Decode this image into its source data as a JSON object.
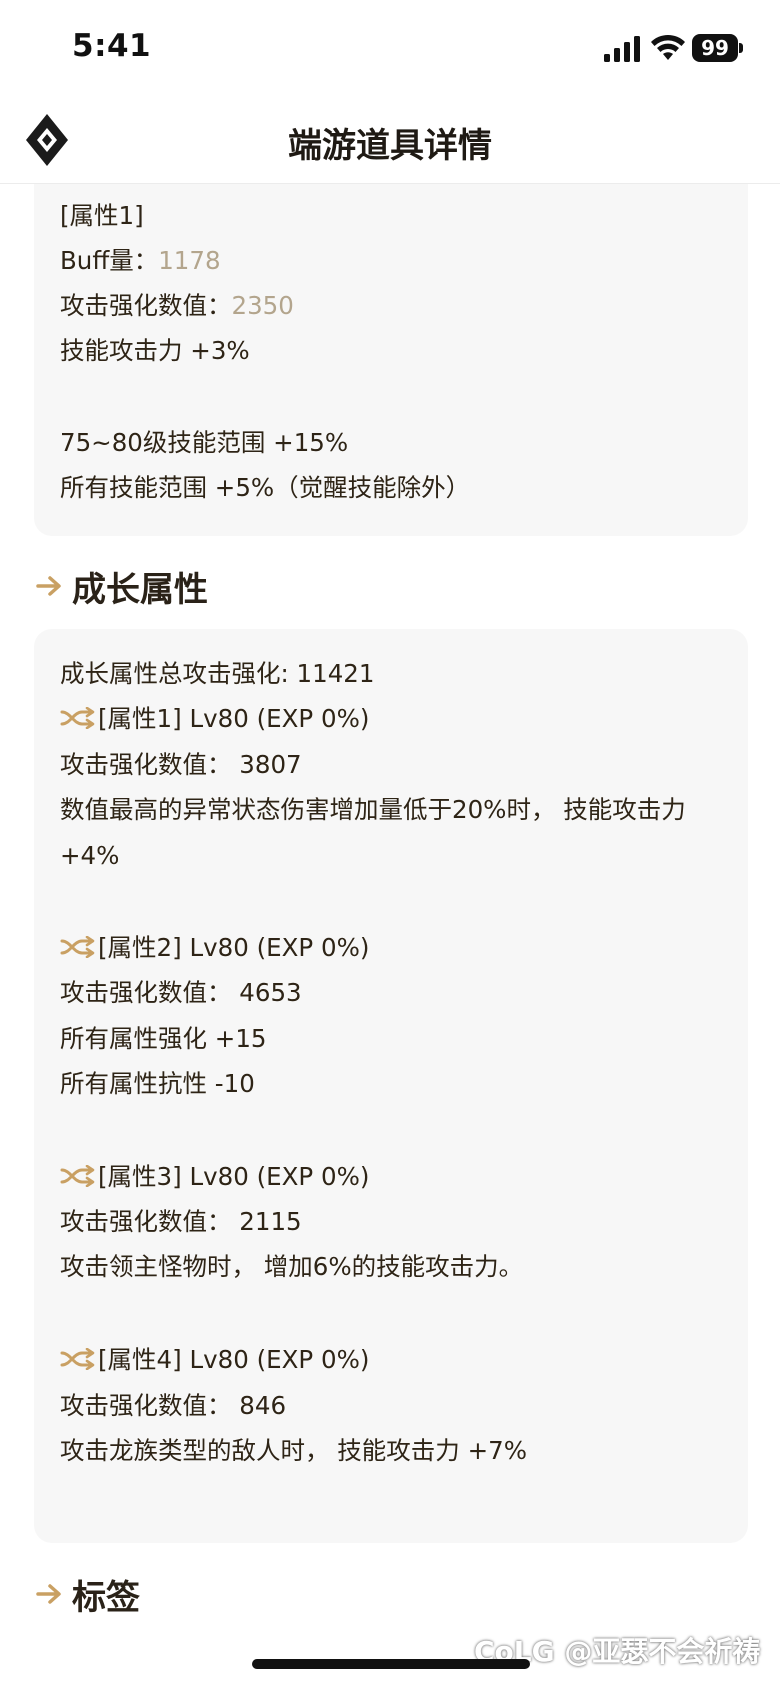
{
  "status_bar": {
    "time": "5:41",
    "battery": "99"
  },
  "header": {
    "title": "端游道具详情"
  },
  "top_card": {
    "lines": [
      {
        "label": "[属性1]",
        "value": ""
      },
      {
        "label": "Buff量：",
        "value": "1178"
      },
      {
        "label": "攻击强化数值：",
        "value": "2350"
      },
      {
        "label": "技能攻击力 +3%",
        "value": ""
      },
      {
        "label": "75~80级技能范围 +15%",
        "value": ""
      },
      {
        "label": "所有技能范围 +5%（觉醒技能除外）",
        "value": ""
      }
    ]
  },
  "growth_section": {
    "title": "成长属性",
    "total": "成长属性总攻击强化: 11421",
    "attrs": [
      {
        "header": "[属性1] Lv80 (EXP 0%)",
        "lines": [
          "攻击强化数值：  3807",
          "数值最高的异常状态伤害增加量低于20%时， 技能攻击力 +4%"
        ]
      },
      {
        "header": "[属性2] Lv80 (EXP 0%)",
        "lines": [
          "攻击强化数值：  4653",
          "所有属性强化 +15",
          "所有属性抗性 -10"
        ]
      },
      {
        "header": "[属性3] Lv80 (EXP 0%)",
        "lines": [
          "攻击强化数值：  2115",
          "攻击领主怪物时， 增加6%的技能攻击力。"
        ]
      },
      {
        "header": "[属性4] Lv80 (EXP 0%)",
        "lines": [
          "攻击强化数值：  846",
          "攻击龙族类型的敌人时， 技能攻击力 +7%"
        ]
      }
    ]
  },
  "tags_section": {
    "title": "标签"
  },
  "watermark": "CoLG @亚瑟不会祈祷",
  "colors": {
    "accent": "#c9a063",
    "muted_value": "#b3a58d",
    "card_bg": "#f7f7f7"
  },
  "icons": {
    "logo": "diamond-logo-icon",
    "section": "arrow-right-icon",
    "attr": "shuffle-icon"
  }
}
